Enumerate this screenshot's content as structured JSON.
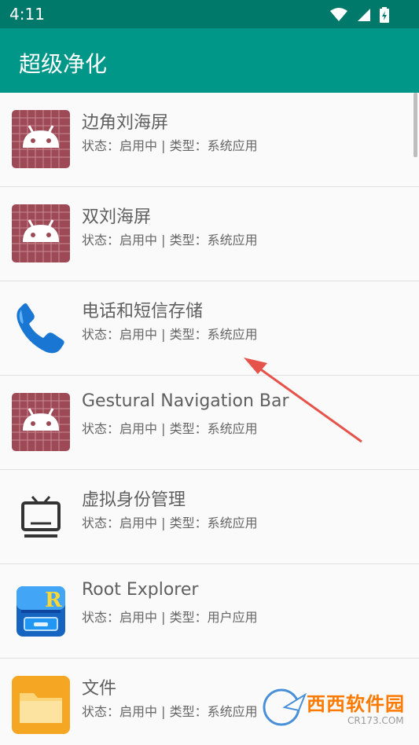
{
  "status_bar": {
    "time": "4:11",
    "icons": [
      "wifi-icon",
      "signal-icon",
      "battery-icon"
    ]
  },
  "app_bar": {
    "title": "超级净化",
    "color": "#009688"
  },
  "apps": [
    {
      "name": "边角刘海屏",
      "status": "状态：启用中 | 类型：系统应用",
      "icon": "android-icon"
    },
    {
      "name": "双刘海屏",
      "status": "状态：启用中 | 类型：系统应用",
      "icon": "android-icon"
    },
    {
      "name": "电话和短信存储",
      "status": "状态：启用中 | 类型：系统应用",
      "icon": "phone-icon"
    },
    {
      "name": "Gestural Navigation Bar",
      "status": "状态：启用中 | 类型：系统应用",
      "icon": "android-icon"
    },
    {
      "name": "虚拟身份管理",
      "status": "状态：启用中 | 类型：系统应用",
      "icon": "tv-icon"
    },
    {
      "name": "Root Explorer",
      "status": "状态：启用中 | 类型：用户应用",
      "icon": "root-explorer-icon"
    },
    {
      "name": "文件",
      "status": "状态：启用中 | 类型：系统应用",
      "icon": "folder-icon"
    }
  ],
  "watermark": {
    "main": "西西软件园",
    "sub": "CR173.COM"
  }
}
